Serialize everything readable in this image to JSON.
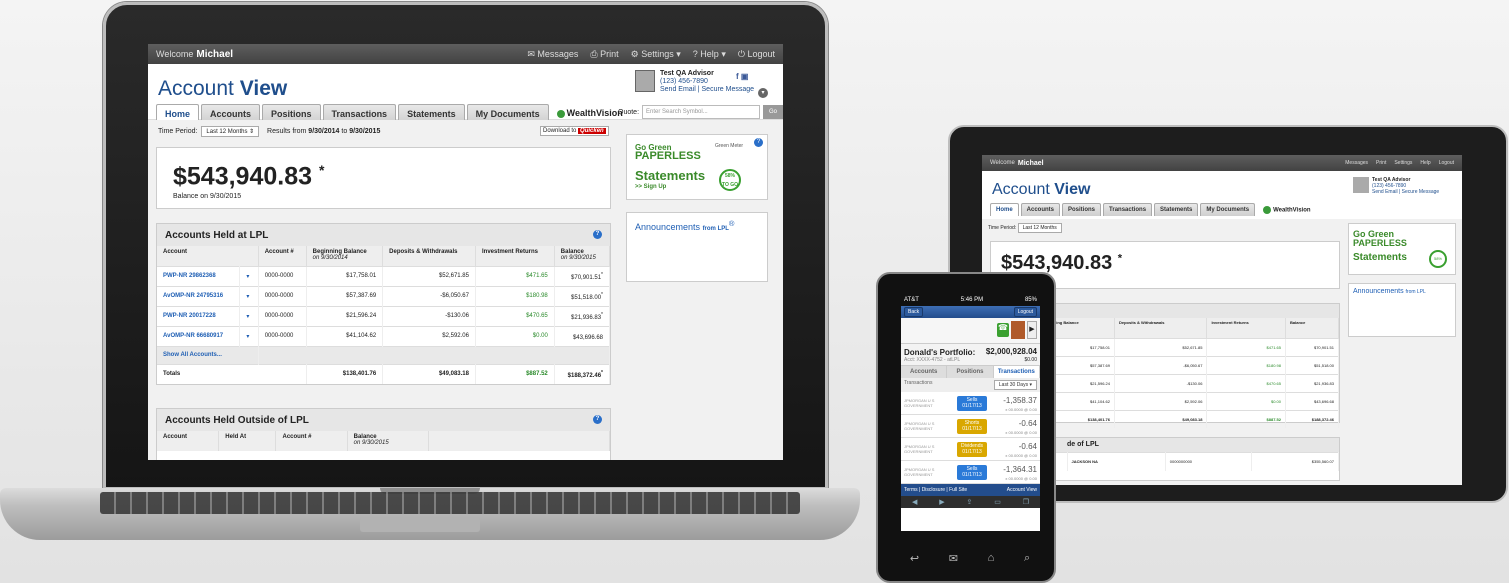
{
  "topbar": {
    "welcome": "Welcome",
    "user": "Michael",
    "messages": "Messages",
    "print": "Print",
    "settings": "Settings",
    "help": "Help",
    "logout": "Logout"
  },
  "header": {
    "title_light": "Account",
    "title_bold": "View",
    "advisor_name": "Test QA Advisor",
    "advisor_phone": "(123) 456-7890",
    "advisor_links": "Send Email | Secure Message"
  },
  "tabs": [
    "Home",
    "Accounts",
    "Positions",
    "Transactions",
    "Statements",
    "My Documents"
  ],
  "wealthvision": "WealthVision",
  "quote": {
    "label": "Quote:",
    "placeholder": "Enter Search Symbol...",
    "go": "Go"
  },
  "period": {
    "label": "Time Period:",
    "value": "Last 12 Months",
    "results_prefix": "Results from",
    "from": "9/30/2014",
    "to_word": "to",
    "to": "9/30/2015"
  },
  "download": {
    "label": "Download to",
    "brand": "Quicken"
  },
  "balance": {
    "value": "$543,940.83",
    "star": "*",
    "caption": "Balance on 9/30/2015"
  },
  "held_lpl": {
    "title": "Accounts Held at LPL",
    "columns": [
      {
        "h": "Account",
        "s": ""
      },
      {
        "h": "Account #",
        "s": ""
      },
      {
        "h": "Beginning Balance",
        "s": "on 9/30/2014"
      },
      {
        "h": "Deposits & Withdrawals",
        "s": ""
      },
      {
        "h": "Investment Returns",
        "s": ""
      },
      {
        "h": "Balance",
        "s": "on 9/30/2015"
      }
    ],
    "rows": [
      {
        "name": "PWP-NR 29862368",
        "num": "0000-0000",
        "begin": "$17,758.01",
        "dep": "$52,671.85",
        "ret": "$471.65",
        "bal": "$70,901.51",
        "star": "*"
      },
      {
        "name": "AvOMP-NR 24795316",
        "num": "0000-0000",
        "begin": "$57,387.69",
        "dep": "-$6,050.67",
        "ret": "$180.98",
        "bal": "$51,518.00",
        "star": "*"
      },
      {
        "name": "PWP-NR 20017228",
        "num": "0000-0000",
        "begin": "$21,596.24",
        "dep": "-$130.06",
        "ret": "$470.65",
        "bal": "$21,936.83",
        "star": "*"
      },
      {
        "name": "AvOMP-NR 66680917",
        "num": "0000-0000",
        "begin": "$41,104.62",
        "dep": "$2,592.06",
        "ret": "$0.00",
        "bal": "$43,696.68",
        "star": ""
      }
    ],
    "show_all": "Show All Accounts...",
    "totals": {
      "label": "Totals",
      "begin": "$138,401.76",
      "dep": "$49,083.18",
      "ret": "$887.52",
      "bal": "$188,372.46",
      "star": "*"
    }
  },
  "held_outside": {
    "title": "Accounts Held Outside of LPL",
    "columns": [
      {
        "h": "Account",
        "s": ""
      },
      {
        "h": "Held At",
        "s": ""
      },
      {
        "h": "Account #",
        "s": ""
      },
      {
        "h": "Balance",
        "s": "on 9/30/2015"
      }
    ]
  },
  "go_green": {
    "l1": "Go Green",
    "l2": "PAPERLESS",
    "l3": "Statements",
    "l4": ">> Sign Up",
    "meter": "Green Meter",
    "pct": "58%",
    "pct_sub": "TO GO"
  },
  "announcements": {
    "title": "Announcements",
    "from": "from LPL",
    "reg": "®"
  },
  "tablet": {
    "outside_row": {
      "held": "JACKSON NA",
      "num": "0000000000",
      "bal": "$355,560.07"
    },
    "outside_title_fragment": "de of LPL"
  },
  "phone": {
    "carrier": "AT&T",
    "time": "5:46 PM",
    "battery": "85%",
    "back": "Back",
    "logout": "Logout",
    "portfolio": "Donald's Portfolio:",
    "acct": "Acct: XXXX-4752 - atLPL",
    "value": "$2,000,928.04",
    "zero": "$0.00",
    "tabs": [
      "Accounts",
      "Positions",
      "Transactions"
    ],
    "filter_label": "Transactions",
    "filter": "Last 30 Days",
    "tx": [
      {
        "lbl": "JPMORGAN U S GOVERNMENT",
        "pill": "Sells",
        "date": "01/17/13",
        "amt": "-1,358.37",
        "sub": "x 00.0000 @ 0.00",
        "kind": "blue"
      },
      {
        "lbl": "JPMORGAN U S GOVERNMENT",
        "pill": "Shorts",
        "date": "01/17/13",
        "amt": "-0.64",
        "sub": "x 00.0000 @ 0.00",
        "kind": "yel"
      },
      {
        "lbl": "JPMORGAN U S GOVERNMENT",
        "pill": "Dividends",
        "date": "01/17/13",
        "amt": "-0.64",
        "sub": "x 00.0000 @ 0.00",
        "kind": "yel"
      },
      {
        "lbl": "JPMORGAN U S GOVERNMENT",
        "pill": "Sells",
        "date": "01/17/13",
        "amt": "-1,364.31",
        "sub": "x 00.0000 @ 0.00",
        "kind": "blue"
      }
    ],
    "footer": "Terms | Disclosure | Full Site",
    "footer_right": "Account View"
  }
}
